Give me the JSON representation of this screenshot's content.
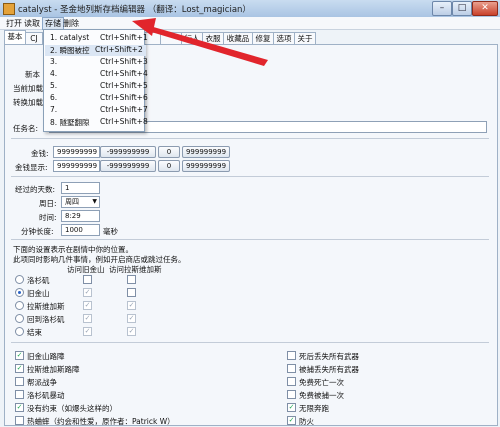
{
  "window": {
    "title": "catalyst - 圣金地列斯存档编辑器 （翻译：Lost_magician）",
    "minimize": "–",
    "maximize": "□",
    "close": "✕"
  },
  "menu": [
    "打开",
    "读取",
    "存储",
    "删除"
  ],
  "tabs": [
    "基本",
    "CJ",
    "",
    "",
    "",
    "",
    "行人",
    "衣服",
    "收藏品",
    "修复",
    "选项",
    "关于"
  ],
  "dropdown": {
    "items": [
      {
        "label": "1. catalyst",
        "shortcut": "Ctrl+Shift+1"
      },
      {
        "label": "2. 瞬图被控",
        "shortcut": "Ctrl+Shift+2"
      },
      {
        "label": "3.",
        "shortcut": "Ctrl+Shift+3"
      },
      {
        "label": "4.",
        "shortcut": "Ctrl+Shift+4"
      },
      {
        "label": "5.",
        "shortcut": "Ctrl+Shift+5"
      },
      {
        "label": "6.",
        "shortcut": "Ctrl+Shift+6"
      },
      {
        "label": "7.",
        "shortcut": "Ctrl+Shift+7"
      },
      {
        "label": "8. 隧墅翻隙",
        "shortcut": "Ctrl+Shift+8"
      }
    ]
  },
  "left_labels": {
    "save_name": "新本",
    "current_load": "当前加载",
    "convert_load": "转换加载"
  },
  "mission": {
    "label": "任务名:",
    "value": ""
  },
  "money": {
    "label": "金钱:",
    "value": "999999999",
    "btn_min": "-999999999",
    "btn_zero": "0",
    "btn_max": "999999999",
    "display_label": "金钱显示:",
    "display_value": "999999999",
    "display_btn_min": "-999999999",
    "display_btn_zero": "0",
    "display_btn_max": "999999999"
  },
  "time": {
    "days_label": "经过的天数:",
    "days_value": "1",
    "week_label": "周日:",
    "week_value": "周四",
    "clock_label": "时间:",
    "clock_value": "8:29",
    "minute_label": "分钟长度:",
    "minute_value": "1000",
    "minute_unit": "毫秒"
  },
  "location": {
    "note1": "下面的设置表示在剧情中你的位置。",
    "note2": "此项同时影响几件事情，例如开启商店或跳过任务。",
    "col1": "访问旧金山",
    "col2": "访问拉斯维加斯",
    "rows": [
      "洛杉矶",
      "旧金山",
      "拉斯维加斯",
      "回到洛杉矶",
      "结束"
    ],
    "selected": "旧金山"
  },
  "left_checks": [
    {
      "label": "旧金山路障",
      "checked": true
    },
    {
      "label": "拉斯维加斯路障",
      "checked": true
    },
    {
      "label": "帮派战争",
      "checked": false
    },
    {
      "label": "洛杉矶暴动",
      "checked": false
    },
    {
      "label": "没有约束（如爆头这样的）",
      "checked": true
    },
    {
      "label": "热蛐蟀（约会和性爱，原作者：Patrick W）",
      "checked": false
    }
  ],
  "right_checks": [
    {
      "label": "死后丢失所有武器",
      "checked": false
    },
    {
      "label": "被捕丢失所有武器",
      "checked": false
    },
    {
      "label": "免费死亡一次",
      "checked": false
    },
    {
      "label": "免费被捕一次",
      "checked": false
    },
    {
      "label": "无限奔跑",
      "checked": true
    },
    {
      "label": "防火",
      "checked": true
    }
  ]
}
